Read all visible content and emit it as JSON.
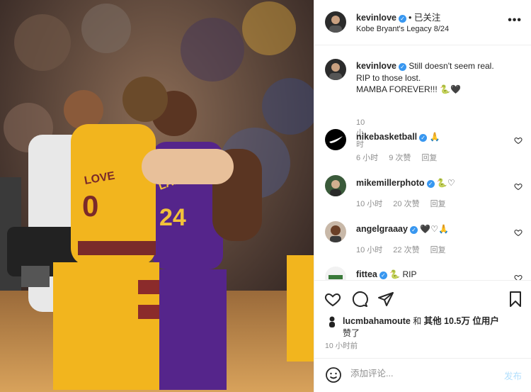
{
  "post_header": {
    "username": "kevinlove",
    "follow_status": "• 已关注",
    "location": "Kobe Bryant's Legacy 8/24"
  },
  "photo": {
    "jersey_left_name": "LOVE",
    "jersey_left_number": "0",
    "jersey_right_text": "LAKERS",
    "jersey_right_number": "24"
  },
  "caption": {
    "username": "kevinlove",
    "text_line1": "Still doesn't seem real.",
    "text_line2": "RIP to those lost.",
    "text_line3": "MAMBA FOREVER!!! 🐍🖤",
    "time": "10 小时"
  },
  "comments": [
    {
      "username": "nikebasketball",
      "text": "🙏",
      "time": "6 小时",
      "likes": "9 次赞",
      "reply": "回复"
    },
    {
      "username": "mikemillerphoto",
      "text": "🐍♡",
      "time": "10 小时",
      "likes": "20 次赞",
      "reply": "回复"
    },
    {
      "username": "angelgraaay",
      "text": "🖤♡🙏",
      "time": "10 小时",
      "likes": "22 次赞",
      "reply": "回复"
    },
    {
      "username": "fittea",
      "text": "🐍 RIP",
      "time": "",
      "likes": "",
      "reply": ""
    }
  ],
  "likes_line": {
    "user": "lucmbahamoute",
    "conj": "和",
    "others": "其他 10.5万 位用户",
    "suffix": "赞了"
  },
  "post_time": "10 小时前",
  "add_comment": {
    "placeholder": "添加评论...",
    "post_label": "发布"
  },
  "icons": {
    "more": "more-horizontal-icon",
    "like": "heart-icon",
    "comment": "comment-bubble-icon",
    "share": "paper-plane-icon",
    "save": "bookmark-icon",
    "emoji": "smiley-icon",
    "verified": "verified-badge-icon"
  },
  "colors": {
    "verified_blue": "#3897f0",
    "post_button": "#b2dffc",
    "muted_text": "#8e8e8e",
    "cavs_gold": "#f2b51e",
    "lakers_purple": "#55258b"
  }
}
